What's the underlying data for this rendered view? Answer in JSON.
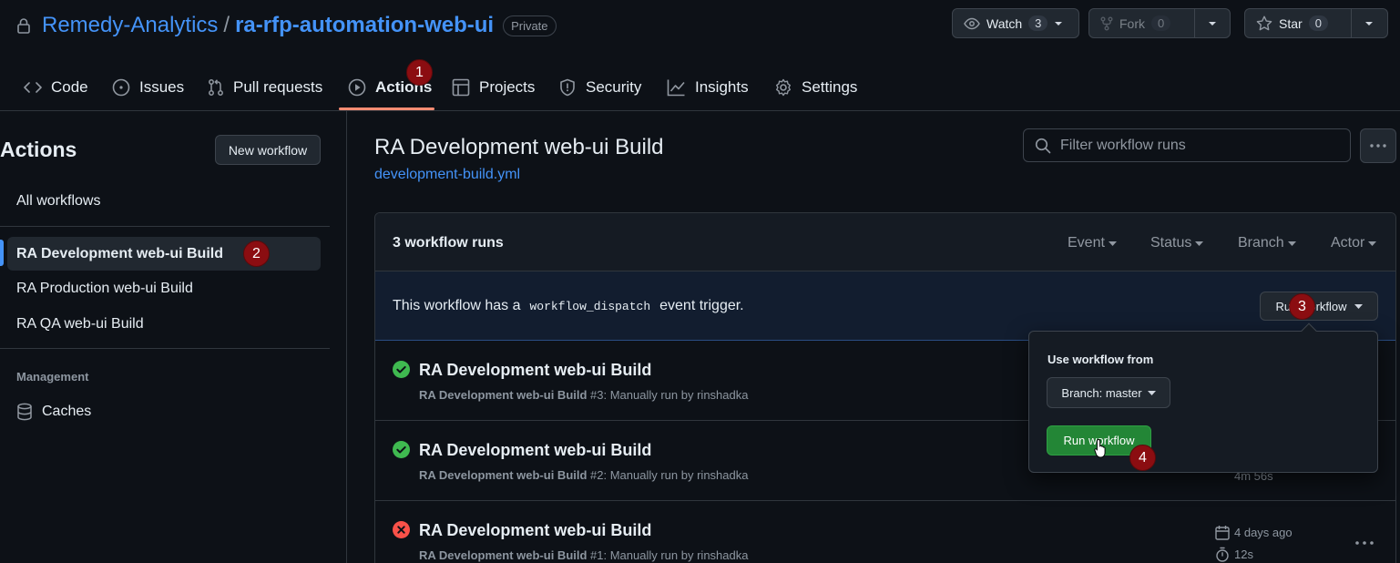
{
  "repo": {
    "owner": "Remedy-Analytics",
    "separator": "/",
    "name": "ra-rfp-automation-web-ui",
    "visibility": "Private"
  },
  "header_buttons": {
    "watch": {
      "label": "Watch",
      "count": "3"
    },
    "fork": {
      "label": "Fork",
      "count": "0"
    },
    "star": {
      "label": "Star",
      "count": "0"
    }
  },
  "tabs": [
    {
      "label": "Code",
      "icon": "code-icon"
    },
    {
      "label": "Issues",
      "icon": "issue-opened-icon"
    },
    {
      "label": "Pull requests",
      "icon": "pull-request-icon"
    },
    {
      "label": "Actions",
      "icon": "play-icon",
      "active": true
    },
    {
      "label": "Projects",
      "icon": "table-icon"
    },
    {
      "label": "Security",
      "icon": "shield-icon"
    },
    {
      "label": "Insights",
      "icon": "graph-icon"
    },
    {
      "label": "Settings",
      "icon": "gear-icon"
    }
  ],
  "annotations": [
    "1",
    "2",
    "3",
    "4"
  ],
  "sidebar": {
    "title": "Actions",
    "new_workflow": "New workflow",
    "all_workflows": "All workflows",
    "workflows": [
      "RA Development web-ui Build",
      "RA Production web-ui Build",
      "RA QA web-ui Build"
    ],
    "management_heading": "Management",
    "caches": "Caches"
  },
  "main": {
    "title": "RA Development web-ui Build",
    "file": "development-build.yml",
    "filter_placeholder": "Filter workflow runs",
    "runs_count": "3 workflow runs",
    "filters": [
      "Event",
      "Status",
      "Branch",
      "Actor"
    ],
    "dispatch_prefix": "This workflow has a",
    "dispatch_code": "workflow_dispatch",
    "dispatch_suffix": "event trigger.",
    "run_workflow_button": "Run workflow",
    "runs": [
      {
        "title": "RA Development web-ui Build",
        "sub_bold": "RA Development web-ui Build",
        "sub_rest": " #3: Manually run by rinshadka",
        "status": "success"
      },
      {
        "title": "RA Development web-ui Build",
        "sub_bold": "RA Development web-ui Build",
        "sub_rest": " #2: Manually run by rinshadka",
        "status": "success",
        "duration": "4m 56s"
      },
      {
        "title": "RA Development web-ui Build",
        "sub_bold": "RA Development web-ui Build",
        "sub_rest": " #1: Manually run by rinshadka",
        "status": "failure",
        "date": "4 days ago",
        "duration": "12s"
      }
    ]
  },
  "popover": {
    "heading": "Use workflow from",
    "branch_button": "Branch: master",
    "run_button": "Run workflow"
  },
  "colors": {
    "accent_link": "#4493f8",
    "success": "#3fb950",
    "failure": "#f85149",
    "annotation": "#8b0d11",
    "run_green": "#238636"
  }
}
